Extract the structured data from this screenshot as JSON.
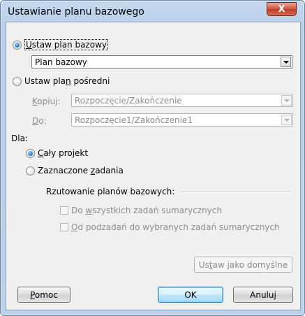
{
  "dialog": {
    "title": "Ustawianie planu bazowego",
    "close_glyph": "X"
  },
  "set_baseline": {
    "label_pre": "",
    "label_acc": "U",
    "label_post": "staw plan bazowy",
    "selected": true,
    "dropdown_value": "Plan bazowy"
  },
  "set_interim": {
    "label_pre": "Ustaw pla",
    "label_acc": "n",
    "label_post": " pośredni",
    "selected": false,
    "copy_label_acc": "K",
    "copy_label_post": "opiuj:",
    "copy_value": "Rozpoczęcie/Zakończenie",
    "into_label_acc": "D",
    "into_label_post": "o:",
    "into_value": "Rozpoczęcie1/Zakończenie1"
  },
  "for_section": {
    "label": "Dla:",
    "entire_project_acc": "C",
    "entire_project_post": "ały projekt",
    "selected_tasks_pre": "Zaznaczone ",
    "selected_tasks_acc": "z",
    "selected_tasks_post": "adania"
  },
  "rollup": {
    "title": "Rzutowanie planów bazowych:",
    "opt1_pre": "Do ",
    "opt1_acc": "w",
    "opt1_post": "szystkich zadań sumarycznych",
    "opt2_pre": "",
    "opt2_acc": "O",
    "opt2_post": "d podzadań do wybranych zadań sumarycznych"
  },
  "buttons": {
    "set_default_pre": "Us",
    "set_default_acc": "t",
    "set_default_post": "aw jako domyślne",
    "help_acc": "P",
    "help_post": "omoc",
    "ok": "OK",
    "cancel": "Anuluj"
  },
  "colors": {
    "accent": "#1f6fd1",
    "disabled_text": "#8d8d8d",
    "close_button": "#c03a24"
  }
}
